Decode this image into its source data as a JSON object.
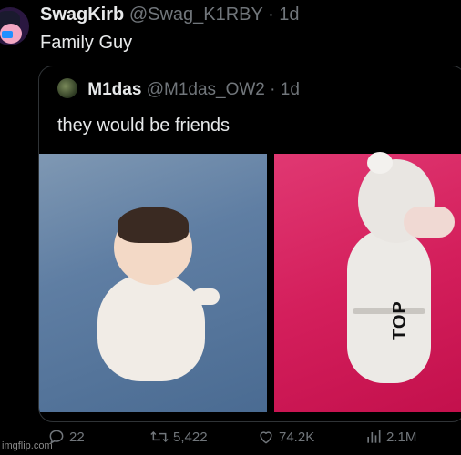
{
  "tweet": {
    "display_name": "SwagKirb",
    "handle": "@Swag_K1RBY",
    "separator": "·",
    "time": "1d",
    "text": "Family Guy"
  },
  "quote": {
    "display_name": "M1das",
    "handle": "@M1das_OW2",
    "separator": "·",
    "time": "1d",
    "text": "they would be friends",
    "media_label": "TOP"
  },
  "actions": {
    "replies": "22",
    "retweets": "5,422",
    "likes": "74.2K",
    "views": "2.1M"
  },
  "watermark": "imgflip.com",
  "colors": {
    "background": "#000000",
    "text": "#e7e9ea",
    "muted": "#71767b",
    "border": "#2f3336"
  }
}
